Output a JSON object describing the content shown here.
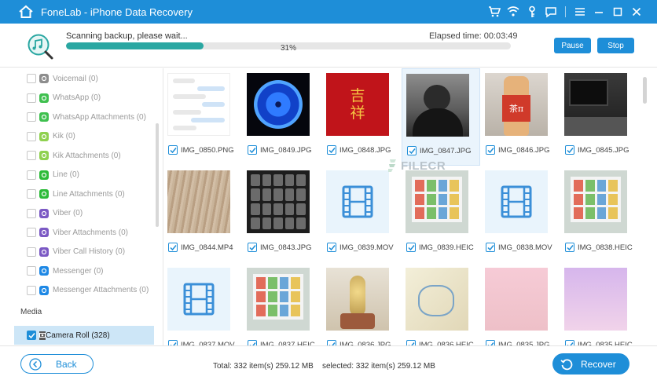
{
  "app": {
    "title": "FoneLab - iPhone Data Recovery"
  },
  "scan": {
    "status": "Scanning backup, please wait...",
    "elapsed": "Elapsed time: 00:03:49",
    "progress_pct": 31,
    "progress_label": "31%",
    "pause_label": "Pause",
    "stop_label": "Stop"
  },
  "sidebar": {
    "items": [
      {
        "label": "Voicemail (0)",
        "icon": "voicemail-icon",
        "color": "#8d8d8d"
      },
      {
        "label": "WhatsApp (0)",
        "icon": "whatsapp-icon",
        "color": "#3fc04f"
      },
      {
        "label": "WhatsApp Attachments (0)",
        "icon": "whatsapp-icon",
        "color": "#3fc04f"
      },
      {
        "label": "Kik (0)",
        "icon": "kik-icon",
        "color": "#8fd14f"
      },
      {
        "label": "Kik Attachments (0)",
        "icon": "kik-icon",
        "color": "#8fd14f"
      },
      {
        "label": "Line (0)",
        "icon": "line-icon",
        "color": "#2dbb39"
      },
      {
        "label": "Line Attachments (0)",
        "icon": "line-icon",
        "color": "#2dbb39"
      },
      {
        "label": "Viber (0)",
        "icon": "viber-icon",
        "color": "#7b59c4"
      },
      {
        "label": "Viber Attachments (0)",
        "icon": "viber-icon",
        "color": "#7b59c4"
      },
      {
        "label": "Viber Call History (0)",
        "icon": "viber-icon",
        "color": "#7b59c4"
      },
      {
        "label": "Messenger (0)",
        "icon": "messenger-icon",
        "color": "#1e88e5"
      },
      {
        "label": "Messenger Attachments (0)",
        "icon": "messenger-icon",
        "color": "#1e88e5"
      }
    ],
    "media_label": "Media",
    "camera_roll": "Camera Roll (328)"
  },
  "files": [
    {
      "name": "IMG_0850.PNG",
      "kind": "chat"
    },
    {
      "name": "IMG_0849.JPG",
      "kind": "flower"
    },
    {
      "name": "IMG_0848.JPG",
      "kind": "red",
      "text": "吉\n祥"
    },
    {
      "name": "IMG_0847.JPG",
      "kind": "person"
    },
    {
      "name": "IMG_0846.JPG",
      "kind": "bottle",
      "text": "茶π"
    },
    {
      "name": "IMG_0845.JPG",
      "kind": "desk"
    },
    {
      "name": "IMG_0844.MP4",
      "kind": "wood"
    },
    {
      "name": "IMG_0843.JPG",
      "kind": "keyboard"
    },
    {
      "name": "IMG_0839.MOV",
      "kind": "video"
    },
    {
      "name": "IMG_0839.HEIC",
      "kind": "screen"
    },
    {
      "name": "IMG_0838.MOV",
      "kind": "video"
    },
    {
      "name": "IMG_0838.HEIC",
      "kind": "screen2"
    },
    {
      "name": "IMG_0837.MOV",
      "kind": "video"
    },
    {
      "name": "IMG_0837.HEIC",
      "kind": "screen3"
    },
    {
      "name": "IMG_0836.JPG",
      "kind": "plant"
    },
    {
      "name": "IMG_0836.HEIC",
      "kind": "drawing"
    },
    {
      "name": "IMG_0835.JPG",
      "kind": "pink"
    },
    {
      "name": "IMG_0835.HEIC",
      "kind": "purple"
    }
  ],
  "watermark": "FILECR",
  "footer": {
    "back_label": "Back",
    "total": "Total: 332 item(s) 259.12 MB",
    "selected": "selected: 332 item(s) 259.12 MB",
    "recover_label": "Recover"
  },
  "colors": {
    "accent": "#1e8ed8",
    "progress": "#2aa7a2"
  }
}
